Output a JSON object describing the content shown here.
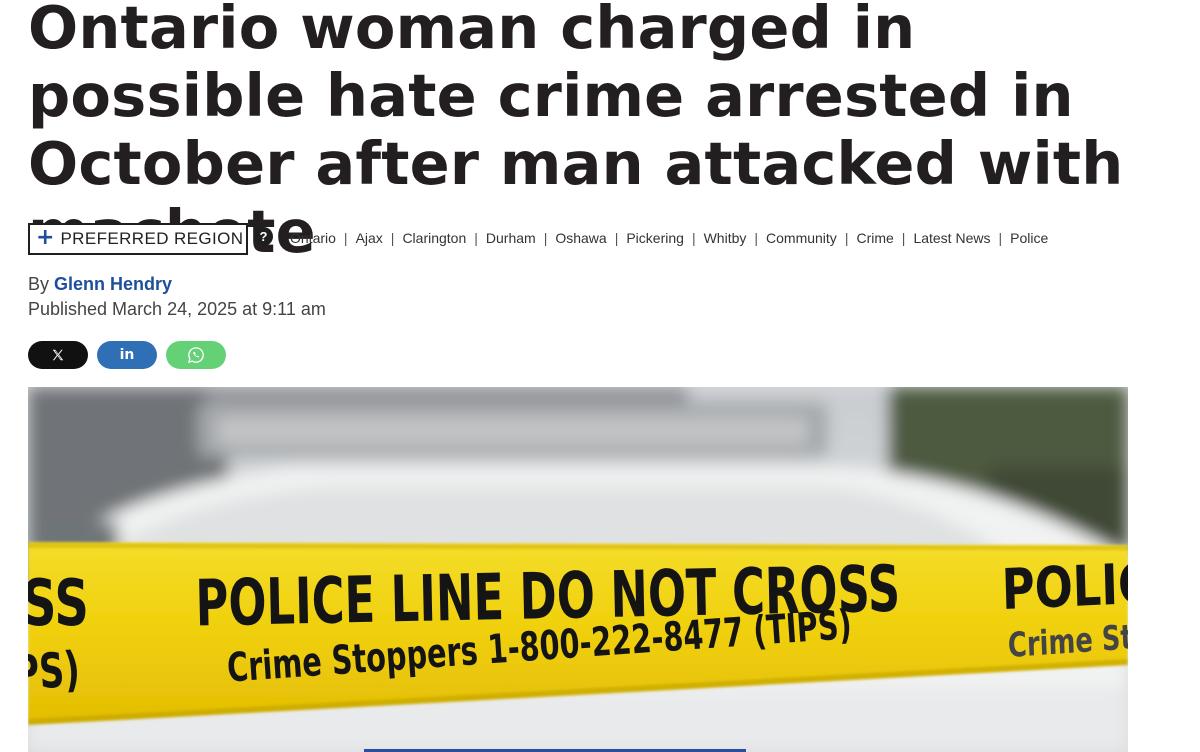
{
  "article": {
    "headline": "Ontario woman charged in possible hate crime arrested in October after man attacked with machete",
    "region_button": {
      "plus": "+",
      "label": "PREFERRED REGION"
    },
    "help_glyph": "?",
    "tags": [
      "Ontario",
      "Ajax",
      "Clarington",
      "Durham",
      "Oshawa",
      "Pickering",
      "Whitby",
      "Community",
      "Crime",
      "Latest News",
      "Police"
    ],
    "tag_separator": "|",
    "byline_prefix": "By",
    "author": "Glenn Hendry",
    "published": "Published March 24, 2025 at 9:11 am"
  },
  "share": {
    "x_icon": "x-logo-icon",
    "linkedin_label": "in",
    "whatsapp_icon": "whatsapp-icon",
    "colors": {
      "x": "#111111",
      "linkedin": "#2e6fb5",
      "whatsapp": "#64d177"
    }
  },
  "hero_image": {
    "tape_line1": "POLICE LINE DO NOT CROSS",
    "tape_line2": "Crime Stoppers 1-800-222-8477 (TIPS)",
    "tape_left_top": "SS",
    "tape_left_bottom": "PS)",
    "tape_right_top": "POLICE",
    "tape_right_bottom": "Crime Sto",
    "tape_color": "#f2d20c"
  },
  "colors": {
    "accent": "#1d4f9c",
    "headline": "#231f20"
  }
}
